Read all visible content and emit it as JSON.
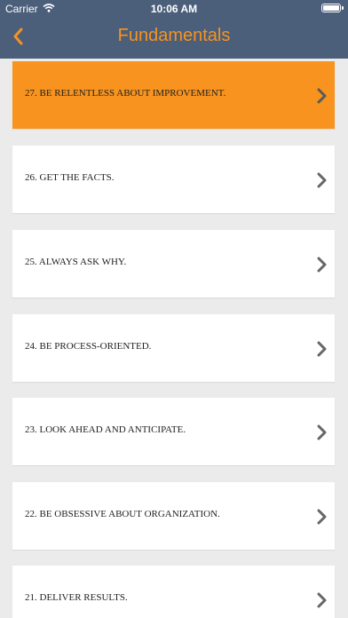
{
  "status_bar": {
    "carrier": "Carrier",
    "time": "10:06 AM"
  },
  "navbar": {
    "title": "Fundamentals",
    "back_icon": "chevron-left-icon"
  },
  "colors": {
    "accent": "#f7931e",
    "navbar_bg": "#4b5f7a",
    "list_bg": "#ebebeb"
  },
  "items": [
    {
      "label": "27. BE RELENTLESS ABOUT IMPROVEMENT.",
      "selected": true
    },
    {
      "label": "26. GET THE FACTS.",
      "selected": false
    },
    {
      "label": "25. ALWAYS ASK WHY.",
      "selected": false
    },
    {
      "label": "24. BE PROCESS-ORIENTED.",
      "selected": false
    },
    {
      "label": "23. LOOK AHEAD AND ANTICIPATE.",
      "selected": false
    },
    {
      "label": "22. BE OBSESSIVE ABOUT ORGANIZATION.",
      "selected": false
    },
    {
      "label": "21. DELIVER RESULTS.",
      "selected": false
    }
  ]
}
